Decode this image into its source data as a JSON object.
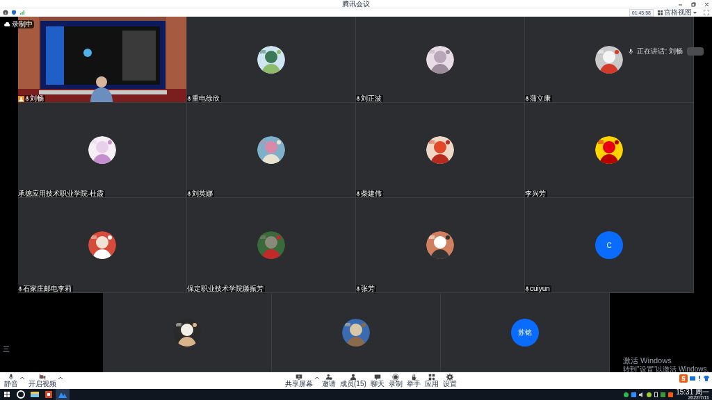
{
  "window": {
    "title": "腾讯会议"
  },
  "header": {
    "timer": "01:45:58",
    "view_button": "宫格视图"
  },
  "recording": {
    "label": "录制中"
  },
  "speaking": {
    "label": "正在讲话: 刘畅"
  },
  "tile_rows": [
    [
      {
        "kind": "video",
        "name": "刘畅",
        "mic": true,
        "host": true
      },
      {
        "kind": "avatar",
        "name": "重电徐欣",
        "mic": true
      },
      {
        "kind": "avatar",
        "name": "刘正波",
        "mic": true
      },
      {
        "kind": "avatar",
        "name": "蒲立康",
        "mic": true
      }
    ],
    [
      {
        "kind": "avatar",
        "name": "承德应用技术职业学院-杜霞",
        "mic": false
      },
      {
        "kind": "avatar",
        "name": "刘英娜",
        "mic": true
      },
      {
        "kind": "avatar",
        "name": "柴建伟",
        "mic": true
      },
      {
        "kind": "avatar",
        "name": "李兴芳",
        "mic": false
      }
    ],
    [
      {
        "kind": "avatar",
        "name": "石家庄邮电李莉",
        "mic": true
      },
      {
        "kind": "avatar",
        "name": "保定职业技术学院滕振芳",
        "mic": false
      },
      {
        "kind": "avatar",
        "name": "张芳",
        "mic": true
      },
      {
        "kind": "letter",
        "letter": "C",
        "name": "cuiyun",
        "mic": true
      }
    ],
    [
      {
        "kind": "avatar"
      },
      {
        "kind": "avatar"
      },
      {
        "kind": "letter",
        "letter": "苏铭"
      }
    ]
  ],
  "side_menu_glyph": "三",
  "toolbar": {
    "left": [
      {
        "label": "静音",
        "menu": true
      },
      {
        "label": "开启视频",
        "menu": true
      }
    ],
    "center": [
      {
        "label": "共享屏幕",
        "menu": true
      },
      {
        "label": "邀请",
        "menu": false
      },
      {
        "label": "成员(15)",
        "menu": false
      },
      {
        "label": "聊天",
        "menu": false
      },
      {
        "label": "录制",
        "menu": false
      },
      {
        "label": "举手",
        "menu": false
      },
      {
        "label": "应用",
        "menu": false
      },
      {
        "label": "设置",
        "menu": false
      }
    ]
  },
  "activation_notice": {
    "title": "激活 Windows",
    "subtitle": "转到\"设置\"以激活 Windows。"
  },
  "taskbar": {
    "time": "15:31 周一",
    "date": "2022/7/11"
  }
}
